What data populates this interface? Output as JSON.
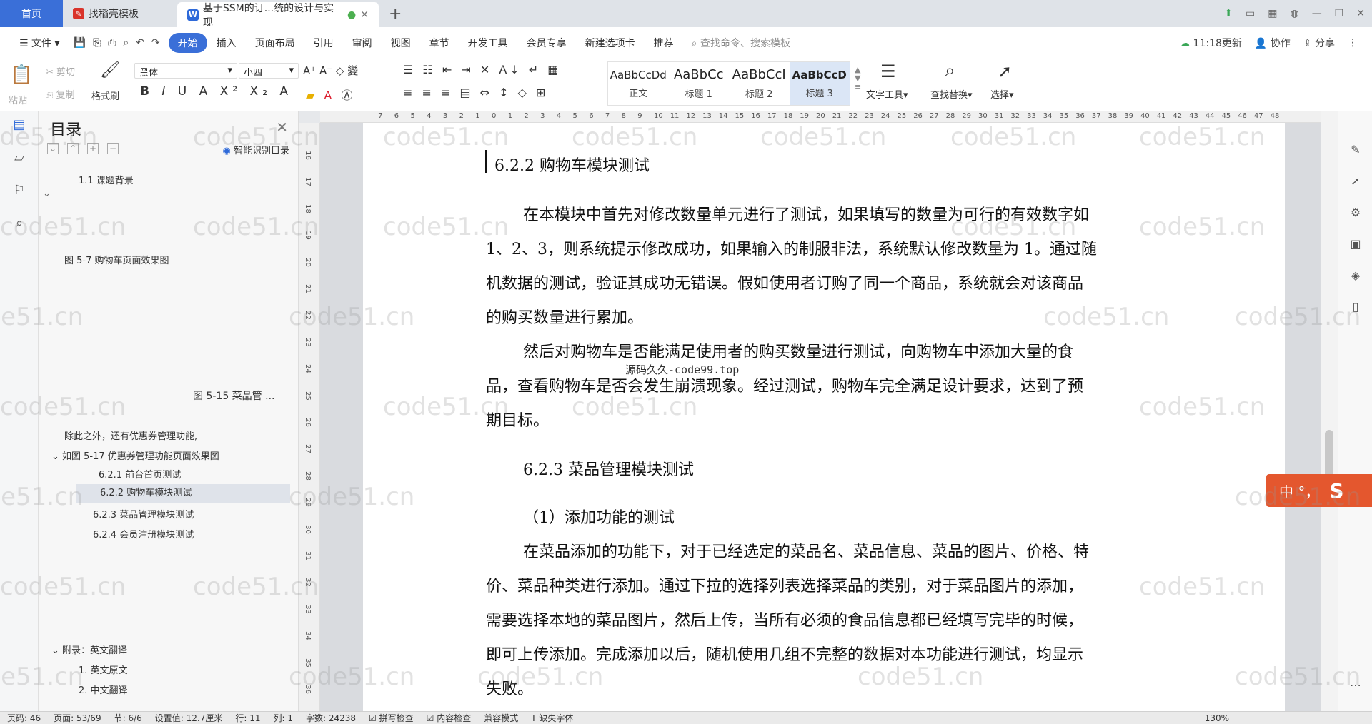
{
  "tabs": {
    "home": "首页",
    "template": "找稻壳模板",
    "doc": "基于SSM的订...统的设计与实现"
  },
  "menu": {
    "file": "文件",
    "items": [
      "开始",
      "插入",
      "页面布局",
      "引用",
      "审阅",
      "视图",
      "章节",
      "开发工具",
      "会员专享",
      "新建选项卡",
      "推荐"
    ],
    "search": "查找命令、搜索模板",
    "sync": "11:18更新",
    "collab": "协作",
    "share": "分享"
  },
  "ribbon": {
    "paste": "粘贴",
    "cut": "剪切",
    "copy": "复制",
    "format_painter": "格式刷",
    "font": "黑体",
    "size": "小四",
    "styles": [
      {
        "preview": "AaBbCcDd",
        "name": "正文"
      },
      {
        "preview": "AaBbCc",
        "name": "标题 1"
      },
      {
        "preview": "AaBbCcI",
        "name": "标题 2"
      },
      {
        "preview": "AaBbCcD",
        "name": "标题 3"
      }
    ],
    "text_tools": "文字工具",
    "find_replace": "查找替换",
    "select": "选择"
  },
  "toc": {
    "title": "目录",
    "smart": "智能识别目录",
    "items": [
      {
        "text": "1.1  课题背景"
      },
      {
        "text": "图 5-7 购物车页面效果图"
      },
      {
        "text": "图 5-15  菜品管 ..."
      },
      {
        "text": "除此之外，还有优惠券管理功能,"
      },
      {
        "text": "如图 5-17 优惠券管理功能页面效果图"
      },
      {
        "text": "6.2.1 前台首页测试"
      },
      {
        "text": "6.2.2 购物车模块测试"
      },
      {
        "text": "6.2.3 菜品管理模块测试"
      },
      {
        "text": "6.2.4 会员注册模块测试"
      },
      {
        "text": "附录：英文翻译"
      },
      {
        "text": "1. 英文原文"
      },
      {
        "text": "2. 中文翻译"
      }
    ]
  },
  "doc": {
    "h_622": "6.2.2 购物车模块测试",
    "p1": [
      "在本模块中首先对修改数量单元进行了测试，如果填写的数量为可行的有效数字如",
      "1、2、3，则系统提示修改成功，如果输入的制服非法，系统默认修改数量为 1。通过随",
      "机数据的测试，验证其成功无错误。假如使用者订购了同一个商品，系统就会对该商品",
      "的购买数量进行累加。"
    ],
    "p2": [
      "然后对购物车是否能满足使用者的购买数量进行测试，向购物车中添加大量的食",
      "品，查看购物车是否会发生崩溃现象。经过测试，购物车完全满足设计要求，达到了预",
      "期目标。"
    ],
    "h_623": "6.2.3 菜品管理模块测试",
    "sub1": "（1）添加功能的测试",
    "p3": [
      "在菜品添加的功能下，对于已经选定的菜品名、菜品信息、菜品的图片、价格、特",
      "价、菜品种类进行添加。通过下拉的选择列表选择菜品的类别，对于菜品图片的添加，",
      "需要选择本地的菜品图片，然后上传，当所有必须的食品信息都已经填写完毕的时候，",
      "即可上传添加。完成添加以后，随机使用几组不完整的数据对本功能进行测试，均显示",
      "失败。"
    ],
    "watermark_mid": "源码久久-code99.top"
  },
  "watermark": "code51.cn",
  "ime": "中 °，",
  "status": {
    "page": "页码: 46",
    "pages": "页面: 53/69",
    "section": "节: 6/6",
    "setting": "设置值: 12.7厘米",
    "row": "行: 11",
    "col": "列: 1",
    "words": "字数: 24238",
    "spell": "拼写检查",
    "content_check": "内容检查",
    "compat": "兼容模式",
    "missing_font": "缺失字体",
    "zoom": "130%"
  }
}
